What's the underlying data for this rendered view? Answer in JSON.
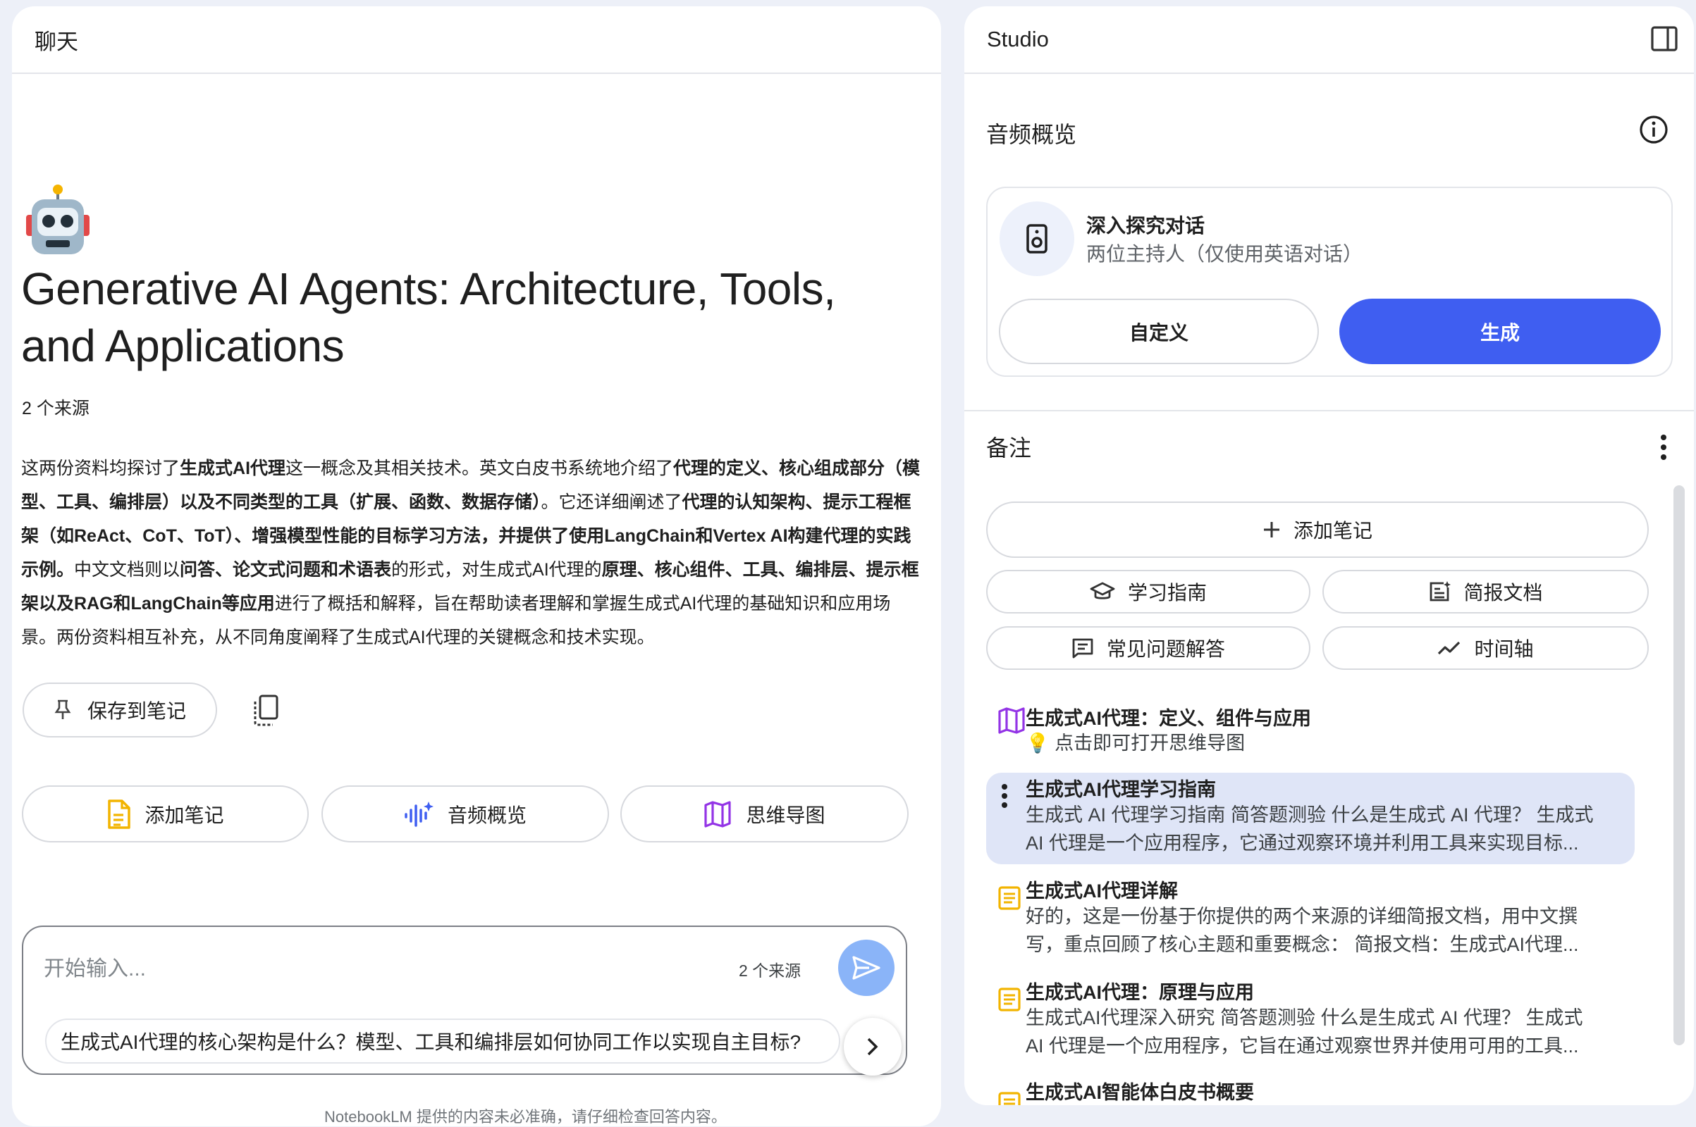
{
  "chat": {
    "header": "聊天",
    "notebook_title": "Generative AI Agents: Architecture, Tools, and Applications",
    "source_count": "2 个来源",
    "summary": [
      {
        "t": "这两份资料均探讨了",
        "b": false
      },
      {
        "t": "生成式AI代理",
        "b": true
      },
      {
        "t": "这一概念及其相关技术。英文白皮书系统地介绍了",
        "b": false
      },
      {
        "t": "代理的定义、核心组成部分（模型、工具、编排层）以及不同类型的工具（扩展、函数、数据存储）",
        "b": true
      },
      {
        "t": "。它还详细阐述了",
        "b": false
      },
      {
        "t": "代理的认知架构、提示工程框架（如ReAct、CoT、ToT）、增强模型性能的目标学习方法，并提供了使用LangChain和Vertex AI构建代理的实践示例。",
        "b": true
      },
      {
        "t": "中文文档则以",
        "b": false
      },
      {
        "t": "问答、论文式问题和术语表",
        "b": true
      },
      {
        "t": "的形式，对生成式AI代理的",
        "b": false
      },
      {
        "t": "原理、核心组件、工具、编排层、提示框架以及RAG和LangChain等应用",
        "b": true
      },
      {
        "t": "进行了概括和解释，旨在帮助读者理解和掌握生成式AI代理的基础知识和应用场景。两份资料相互补充，从不同角度阐释了生成式AI代理的关键概念和技术实现。",
        "b": false
      }
    ],
    "save_to_note": "保存到笔记",
    "actions": [
      "添加笔记",
      "音频概览",
      "思维导图"
    ],
    "input_placeholder": "开始输入...",
    "input_source_count": "2 个来源",
    "suggestion": "生成式AI代理的核心架构是什么？模型、工具和编排层如何协同工作以实现自主目标?",
    "footnote": "NotebookLM 提供的内容未必准确，请仔细检查回答内容。"
  },
  "studio": {
    "header": "Studio",
    "audio_section": "音频概览",
    "deep_dive_title": "深入探究对话",
    "deep_dive_sub": "两位主持人（仅使用英语对话）",
    "customize": "自定义",
    "generate": "生成",
    "notes_section": "备注",
    "add_note": "添加笔记",
    "tiles": [
      "学习指南",
      "简报文档",
      "常见问题解答",
      "时间轴"
    ],
    "notes": [
      {
        "title": "生成式AI代理：定义、组件与应用",
        "body": "💡 点击即可打开思维导图"
      },
      {
        "title": "生成式AI代理学习指南",
        "body1": "生成式 AI 代理学习指南 简答题测验 什么是生成式 AI 代理？ 生成式",
        "body2": "AI 代理是一个应用程序，它通过观察环境并利用工具来实现目标..."
      },
      {
        "title": "生成式AI代理详解",
        "body1": "好的，这是一份基于你提供的两个来源的详细简报文档，用中文撰",
        "body2": "写，重点回顾了核心主题和重要概念： 简报文档：生成式AI代理..."
      },
      {
        "title": "生成式AI代理：原理与应用",
        "body1": "生成式AI代理深入研究 简答题测验 什么是生成式 AI 代理？ 生成式",
        "body2": "AI 代理是一个应用程序，它旨在通过观察世界并使用可用的工具..."
      },
      {
        "title": "生成式AI智能体白皮书概要"
      }
    ]
  },
  "colors": {
    "accent": "#3f5ef1",
    "send": "#8ab4f8",
    "note_highlight": "#dfe5f7",
    "note_icon": "#f2b400",
    "mindmap": "#9334e6"
  }
}
